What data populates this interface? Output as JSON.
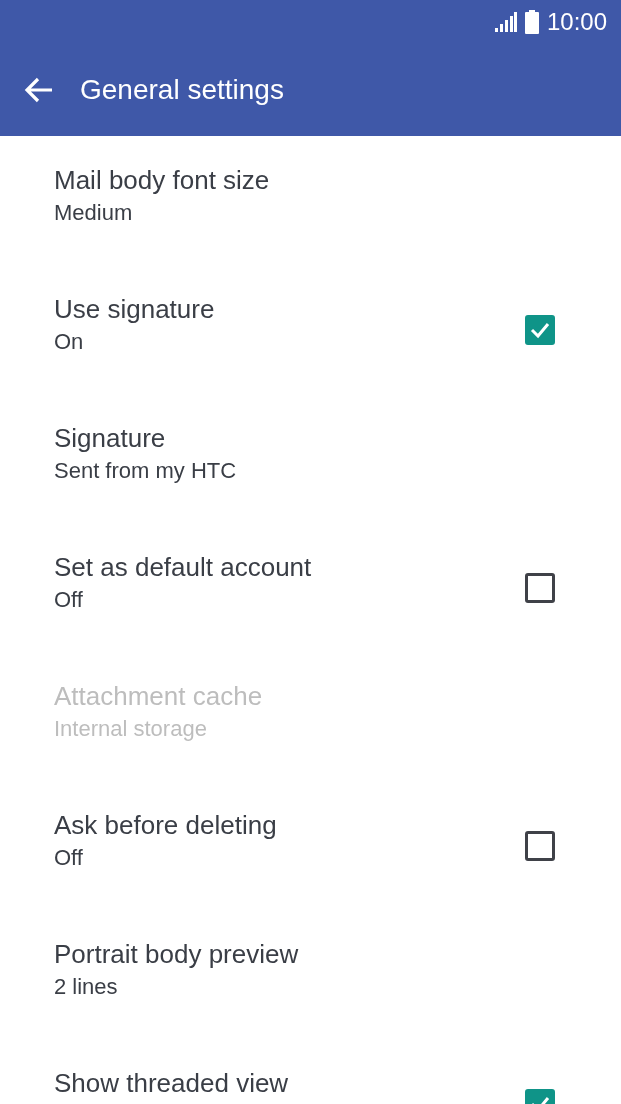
{
  "status_bar": {
    "time": "10:00"
  },
  "toolbar": {
    "title": "General settings"
  },
  "settings": [
    {
      "kind": "plain",
      "title": "Mail body font size",
      "summary": "Medium",
      "disabled": false
    },
    {
      "kind": "checkbox",
      "title": "Use signature",
      "summary": "On",
      "checked": true,
      "disabled": false
    },
    {
      "kind": "plain",
      "title": "Signature",
      "summary": "Sent from my HTC",
      "disabled": false
    },
    {
      "kind": "checkbox",
      "title": "Set as default account",
      "summary": "Off",
      "checked": false,
      "disabled": false
    },
    {
      "kind": "plain",
      "title": "Attachment cache",
      "summary": "Internal storage",
      "disabled": true
    },
    {
      "kind": "checkbox",
      "title": "Ask before deleting",
      "summary": "Off",
      "checked": false,
      "disabled": false
    },
    {
      "kind": "plain",
      "title": "Portrait body preview",
      "summary": "2 lines",
      "disabled": false
    },
    {
      "kind": "checkbox",
      "title": "Show threaded view",
      "checked": true,
      "disabled": false
    }
  ]
}
